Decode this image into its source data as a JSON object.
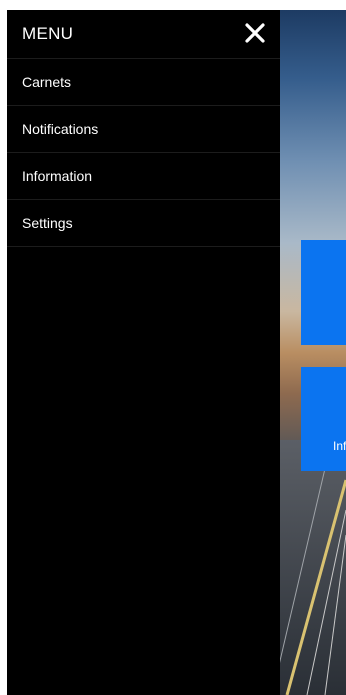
{
  "menu": {
    "title": "MENU",
    "close_icon": "close-icon",
    "items": [
      {
        "label": "Carnets"
      },
      {
        "label": "Notifications"
      },
      {
        "label": "Information"
      },
      {
        "label": "Settings"
      }
    ]
  },
  "background": {
    "tiles": [
      {
        "label": ""
      },
      {
        "label": "Inf"
      }
    ]
  },
  "colors": {
    "drawer": "#000000",
    "tile": "#0b74f0",
    "text": "#ffffff",
    "divider": "#1c1c1c"
  }
}
